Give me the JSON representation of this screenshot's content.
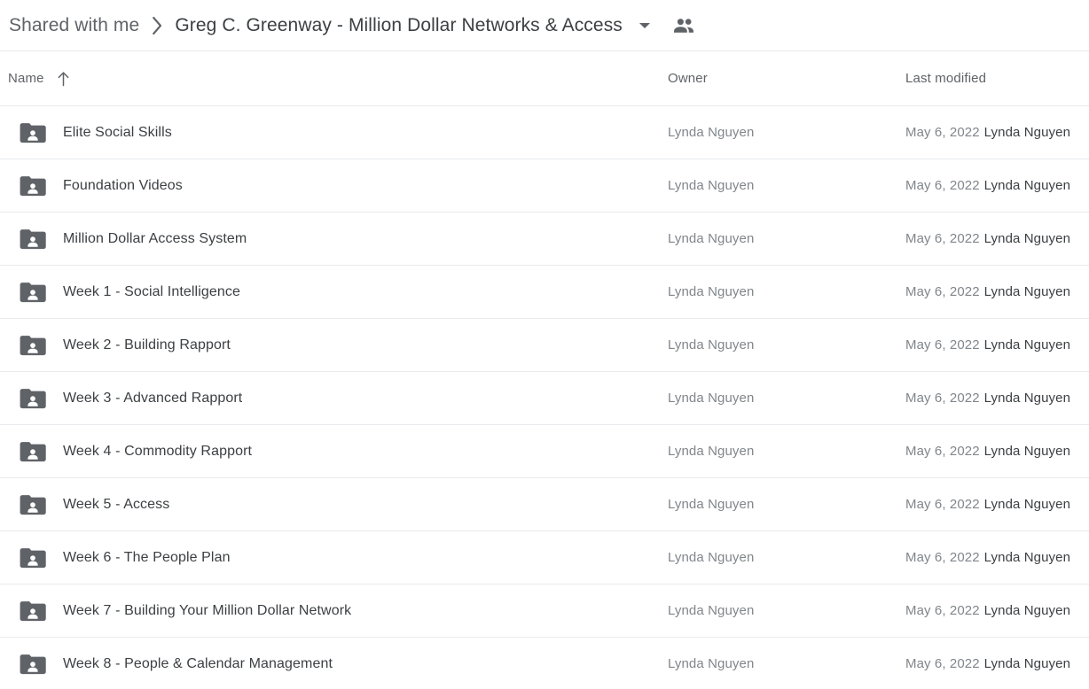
{
  "breadcrumb": {
    "parent": "Shared with me",
    "separator_icon": "chevron-right-icon",
    "current": "Greg C. Greenway - Million Dollar Networks & Access",
    "caret_icon": "chevron-down-icon",
    "people_icon": "people-shared-icon"
  },
  "columns": {
    "name": "Name",
    "name_sort_icon": "arrow-up-icon",
    "owner": "Owner",
    "last_modified": "Last modified"
  },
  "colors": {
    "text_primary": "#3c4043",
    "text_secondary": "#5f6368",
    "text_muted": "#80868b",
    "divider": "#e8eaed",
    "folder": "#5f6368",
    "background": "#ffffff"
  },
  "rows": [
    {
      "icon": "shared-folder-icon",
      "name": "Elite Social Skills",
      "owner": "Lynda Nguyen",
      "modified_date": "May 6, 2022",
      "modified_by": "Lynda Nguyen"
    },
    {
      "icon": "shared-folder-icon",
      "name": "Foundation Videos",
      "owner": "Lynda Nguyen",
      "modified_date": "May 6, 2022",
      "modified_by": "Lynda Nguyen"
    },
    {
      "icon": "shared-folder-icon",
      "name": "Million Dollar Access System",
      "owner": "Lynda Nguyen",
      "modified_date": "May 6, 2022",
      "modified_by": "Lynda Nguyen"
    },
    {
      "icon": "shared-folder-icon",
      "name": "Week 1 - Social Intelligence",
      "owner": "Lynda Nguyen",
      "modified_date": "May 6, 2022",
      "modified_by": "Lynda Nguyen"
    },
    {
      "icon": "shared-folder-icon",
      "name": "Week 2 - Building Rapport",
      "owner": "Lynda Nguyen",
      "modified_date": "May 6, 2022",
      "modified_by": "Lynda Nguyen"
    },
    {
      "icon": "shared-folder-icon",
      "name": "Week 3 - Advanced Rapport",
      "owner": "Lynda Nguyen",
      "modified_date": "May 6, 2022",
      "modified_by": "Lynda Nguyen"
    },
    {
      "icon": "shared-folder-icon",
      "name": "Week 4 - Commodity Rapport",
      "owner": "Lynda Nguyen",
      "modified_date": "May 6, 2022",
      "modified_by": "Lynda Nguyen"
    },
    {
      "icon": "shared-folder-icon",
      "name": "Week 5 - Access",
      "owner": "Lynda Nguyen",
      "modified_date": "May 6, 2022",
      "modified_by": "Lynda Nguyen"
    },
    {
      "icon": "shared-folder-icon",
      "name": "Week 6 - The People Plan",
      "owner": "Lynda Nguyen",
      "modified_date": "May 6, 2022",
      "modified_by": "Lynda Nguyen"
    },
    {
      "icon": "shared-folder-icon",
      "name": "Week 7 - Building Your Million Dollar Network",
      "owner": "Lynda Nguyen",
      "modified_date": "May 6, 2022",
      "modified_by": "Lynda Nguyen"
    },
    {
      "icon": "shared-folder-icon",
      "name": "Week 8 - People & Calendar Management",
      "owner": "Lynda Nguyen",
      "modified_date": "May 6, 2022",
      "modified_by": "Lynda Nguyen"
    }
  ]
}
